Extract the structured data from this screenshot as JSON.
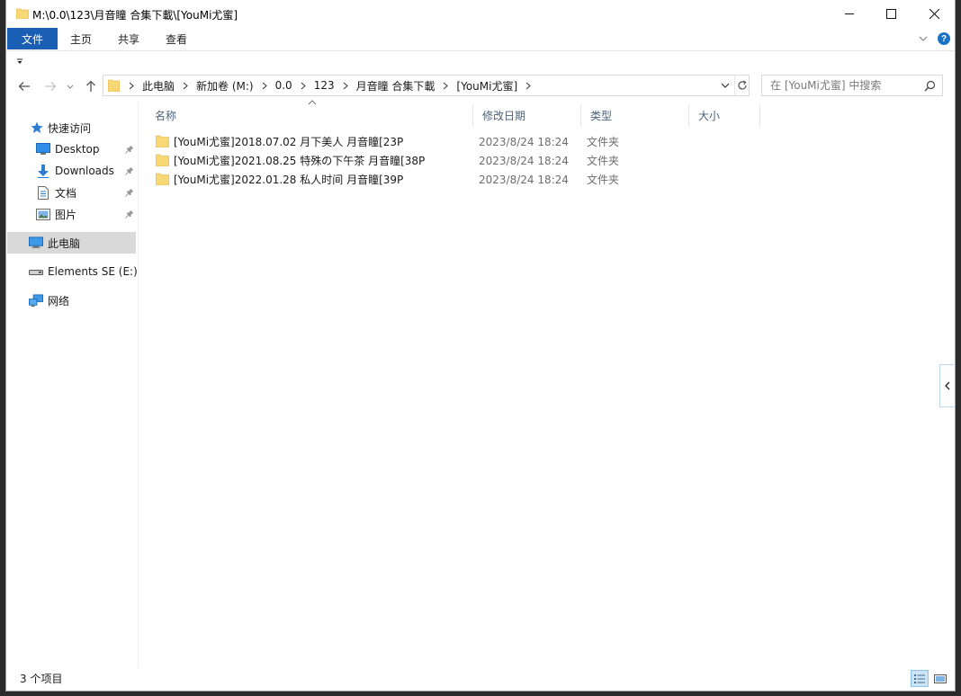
{
  "window": {
    "title": "M:\\0.0\\123\\月音瞳 合集下載\\[YouMi尤蜜]"
  },
  "ribbon": {
    "tabs": {
      "file": "文件",
      "home": "主页",
      "share": "共享",
      "view": "查看"
    },
    "help_glyph": "?"
  },
  "address": {
    "crumbs": [
      "此电脑",
      "新加卷 (M:)",
      "0.0",
      "123",
      "月音瞳 合集下載",
      "[YouMi尤蜜]"
    ]
  },
  "search": {
    "placeholder": "在 [YouMi尤蜜] 中搜索"
  },
  "sidebar": {
    "quick_access": "快速访问",
    "pinned": [
      {
        "label": "Desktop",
        "icon": "desktop-icon"
      },
      {
        "label": "Downloads",
        "icon": "downloads-icon"
      },
      {
        "label": "文档",
        "icon": "documents-icon"
      },
      {
        "label": "图片",
        "icon": "pictures-icon"
      }
    ],
    "this_pc": "此电脑",
    "drive": "Elements SE (E:)",
    "network": "网络"
  },
  "columns": {
    "name": "名称",
    "date": "修改日期",
    "type": "类型",
    "size": "大小"
  },
  "files": [
    {
      "name": "[YouMi尤蜜]2018.07.02 月下美人 月音瞳[23P",
      "date": "2023/8/24 18:24",
      "type": "文件夹",
      "size": ""
    },
    {
      "name": "[YouMi尤蜜]2021.08.25 特殊の下午茶 月音瞳[38P",
      "date": "2023/8/24 18:24",
      "type": "文件夹",
      "size": ""
    },
    {
      "name": "[YouMi尤蜜]2022.01.28 私人时间 月音瞳[39P",
      "date": "2023/8/24 18:24",
      "type": "文件夹",
      "size": ""
    }
  ],
  "status": {
    "item_count": "3 个项目"
  },
  "colors": {
    "accent": "#1a5fb4",
    "folder": "#f8d775",
    "folder_dark": "#e8b84a",
    "header_text": "#4c607a",
    "selected": "#d9d9d9"
  }
}
